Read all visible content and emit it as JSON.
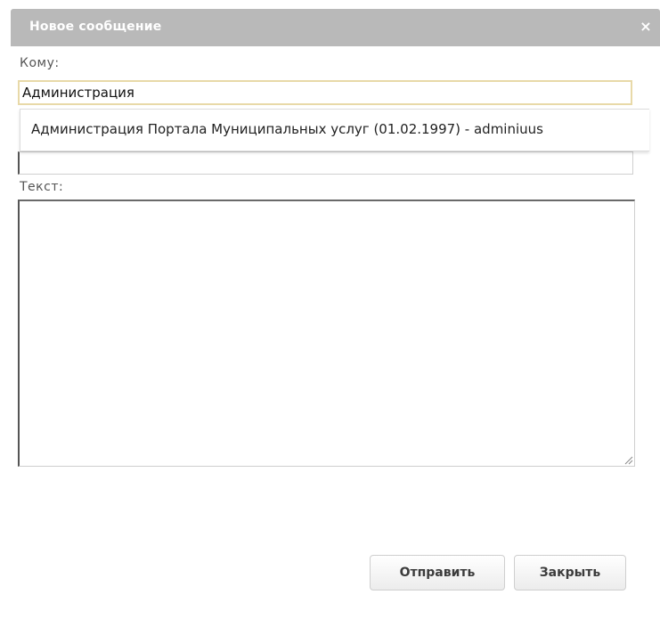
{
  "dialog": {
    "title": "Новое сообщение",
    "close_glyph": "×"
  },
  "form": {
    "to_label": "Кому:",
    "to_value": "Администрация",
    "text_label": "Текст:"
  },
  "autocomplete": {
    "items": [
      "Администрация Портала Муниципальных услуг (01.02.1997) - adminiuus"
    ]
  },
  "buttons": {
    "send": "Отправить",
    "close": "Закрыть"
  },
  "colors": {
    "titlebar": "#b9b9b9",
    "focus_border": "#e8d9a8"
  },
  "icons": {
    "close": "close-icon",
    "resize": "resize-grip-icon"
  }
}
